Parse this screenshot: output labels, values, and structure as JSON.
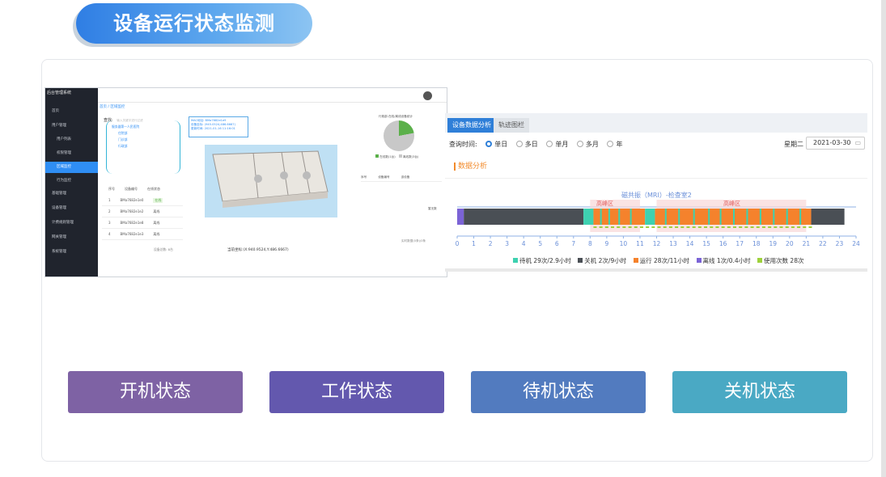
{
  "page_title": "设备运行状态监测",
  "left_screenshot": {
    "app_name": "后台管理系统",
    "sidebar_items": [
      "首页",
      "用户管理",
      "用户列表",
      "权限管理",
      "区域监控",
      "行为监控",
      "基础管理",
      "设备管理",
      "计费规则管理",
      "网关管理",
      "系统管理"
    ],
    "active_item": "区域监控",
    "breadcrumb": "首页 / 区域监控",
    "search_label": "查找:",
    "search_placeholder": "输入关键字进行过滤",
    "tree_root": "服务器第一人民医院",
    "tree_items": [
      "住院部",
      "门诊部",
      "行政部"
    ],
    "table_headers": [
      "序号",
      "设备编号",
      "在线状态"
    ],
    "table_rows": [
      [
        "1",
        "BMa7682e1e0",
        "在线"
      ],
      [
        "2",
        "BMa7682e1e2",
        "离线"
      ],
      [
        "3",
        "BMa7682e1e8",
        "离线"
      ],
      [
        "4",
        "BMa7682e1e3",
        "离线"
      ]
    ],
    "device_count_label": "设备总数: 8台",
    "tooltip_lines": [
      "MAC地址: BMa7682e1e9",
      "设备坐标: (945.0524,486.6667)",
      "更新时间: 2021-01-16 11:16:01"
    ],
    "pie_title": "行政部-在线/离线设备统计",
    "pie_legend": [
      "在线数(1台)",
      "离线数(3台)"
    ],
    "right_table_headers": [
      "序号",
      "设备编号",
      "该设备"
    ],
    "right_table_note": "暂无数",
    "right_count": "实时数据(0条)/0条",
    "coordinate": "当前坐标:(X:940.9524,Y:486.6667)"
  },
  "right_screenshot": {
    "tabs": [
      "设备数据分析",
      "轨迹图栏"
    ],
    "query_label": "查询时间:",
    "radio_options": [
      "单日",
      "多日",
      "单月",
      "多月",
      "年"
    ],
    "selected_option": "单日",
    "weekday": "星期二",
    "date": "2021-03-30",
    "section_title": "数据分析",
    "device_label": "磁共振（MRI）-检查室2",
    "peak_labels": [
      "高峰区",
      "高峰区"
    ],
    "hours": [
      "0",
      "1",
      "2",
      "3",
      "4",
      "5",
      "6",
      "7",
      "8",
      "9",
      "10",
      "11",
      "12",
      "13",
      "14",
      "15",
      "16",
      "17",
      "18",
      "19",
      "20",
      "21",
      "22",
      "23",
      "24"
    ],
    "legend": [
      {
        "label": "待机 29次/2.9小时",
        "color": "#3ed1b0"
      },
      {
        "label": "关机 2次/9小时",
        "color": "#4a4f55"
      },
      {
        "label": "运行 28次/11小时",
        "color": "#f5822c"
      },
      {
        "label": "离线 1次/0.4小时",
        "color": "#7b63d6"
      },
      {
        "label": "使用次数 28次",
        "color": "#9ed13c"
      }
    ]
  },
  "status_buttons": [
    {
      "label": "开机状态",
      "color": "#7e62a4"
    },
    {
      "label": "工作状态",
      "color": "#6358ae"
    },
    {
      "label": "待机状态",
      "color": "#527bbf"
    },
    {
      "label": "关机状态",
      "color": "#4aa9c4"
    }
  ]
}
